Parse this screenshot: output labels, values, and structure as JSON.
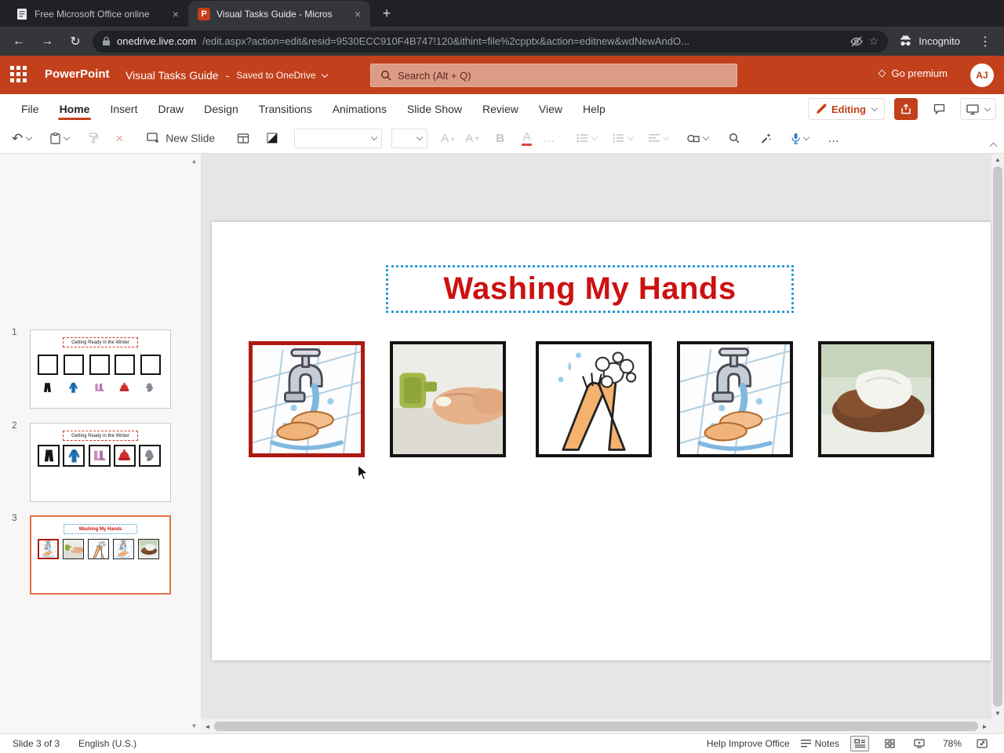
{
  "colors": {
    "brand": "#C2401C",
    "title_red": "#CC1111",
    "selection_blue": "#2E9BD6",
    "selected_slide_border": "#E0714A",
    "image1_border": "#AE1A12",
    "image_border": "#141414"
  },
  "browser": {
    "tab1_title": "Free Microsoft Office online",
    "tab2_title": "Visual Tasks Guide - Micros",
    "incognito_label": "Incognito",
    "url_domain": "onedrive.live.com",
    "url_path": "/edit.aspx?action=edit&resid=9530ECC910F4B747!120&ithint=file%2cpptx&action=editnew&wdNewAndO..."
  },
  "header": {
    "app_name": "PowerPoint",
    "doc_title": "Visual Tasks Guide",
    "separator": "-",
    "save_status": "Saved to OneDrive",
    "search_placeholder": "Search (Alt + Q)",
    "premium_label": "Go premium",
    "avatar_initials": "AJ"
  },
  "menu": {
    "items": [
      "File",
      "Home",
      "Insert",
      "Draw",
      "Design",
      "Transitions",
      "Animations",
      "Slide Show",
      "Review",
      "View",
      "Help"
    ],
    "editing_label": "Editing"
  },
  "toolbar": {
    "new_slide_label": "New Slide"
  },
  "slides_panel": {
    "slides": [
      {
        "number": "1",
        "title": "Getting Ready in the Winter"
      },
      {
        "number": "2",
        "title": "Getting Ready in the Winter"
      },
      {
        "number": "3",
        "title": "Washing My Hands"
      }
    ]
  },
  "slide": {
    "title": "Washing My Hands",
    "images": [
      "faucet-hands-clipart",
      "soap-dispenser-photo",
      "scrubbing-hands-clipart",
      "faucet-hands-clipart",
      "towel-drying-photo"
    ]
  },
  "status": {
    "slide_indicator": "Slide 3 of 3",
    "language": "English (U.S.)",
    "help_improve": "Help Improve Office",
    "notes_label": "Notes",
    "zoom": "78%"
  },
  "glyphs": {
    "back": "←",
    "forward": "→",
    "reload": "↻",
    "kebab": "⋮",
    "star": "☆",
    "close": "×",
    "plus": "+",
    "undo": "↶",
    "bold": "B",
    "font_letter": "A",
    "up": "▴",
    "down": "▾",
    "ellipsis": "…",
    "premium_diamond": "◇",
    "ppt_logo": "P",
    "scroll_up": "▲",
    "scroll_down": "▼",
    "scroll_left": "◄",
    "scroll_right": "►"
  }
}
